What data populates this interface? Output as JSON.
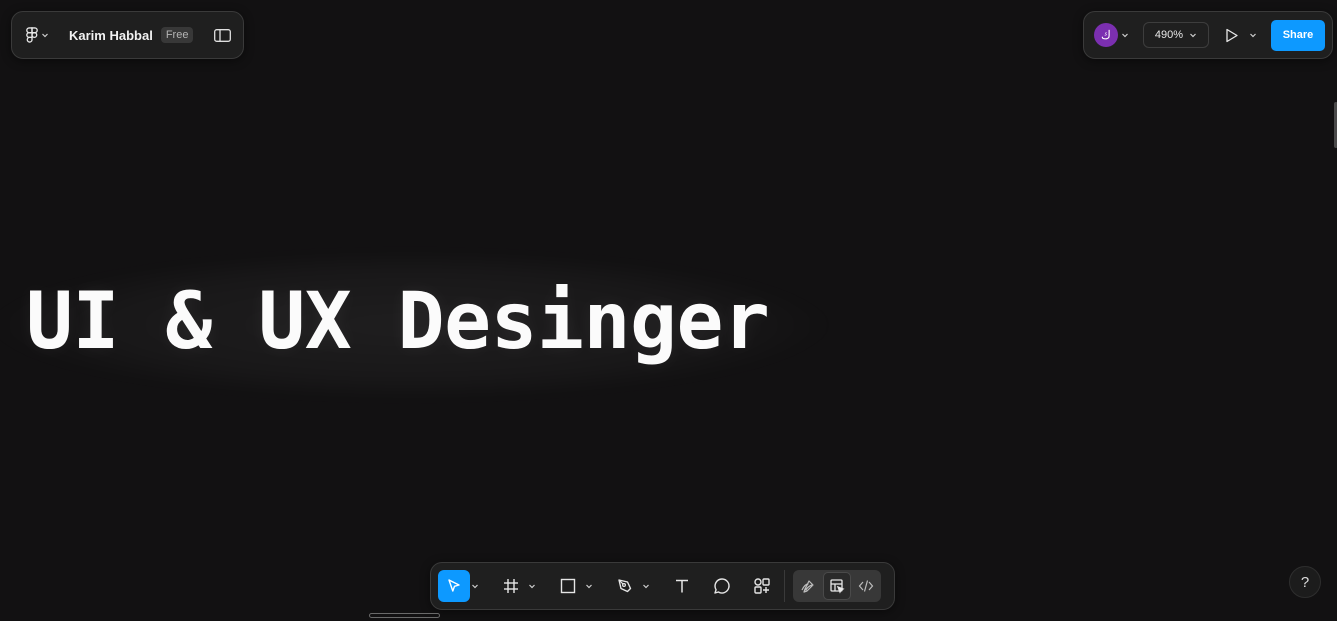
{
  "header": {
    "logo_icon": "figma-logo-icon",
    "owner_name": "Karim Habbal",
    "plan_badge": "Free",
    "sidebar_toggle_icon": "sidebar-panel-icon"
  },
  "top_right": {
    "avatar_initial": "ك",
    "avatar_color": "#7b2fb0",
    "zoom_level": "490%",
    "present_icon": "play-icon",
    "share_label": "Share",
    "share_color": "#0d99ff"
  },
  "canvas": {
    "text": "UI & UX Desinger"
  },
  "toolbar": {
    "tools": [
      {
        "name": "move",
        "icon": "cursor-icon",
        "active": true
      },
      {
        "name": "frame",
        "icon": "frame-hash-icon"
      },
      {
        "name": "shape",
        "icon": "rectangle-icon"
      },
      {
        "name": "pen",
        "icon": "pen-icon"
      },
      {
        "name": "text",
        "icon": "text-icon"
      },
      {
        "name": "comment",
        "icon": "comment-icon"
      },
      {
        "name": "resources",
        "icon": "resources-icon"
      }
    ],
    "modes": [
      {
        "name": "draw",
        "icon": "draw-mode-icon"
      },
      {
        "name": "design",
        "icon": "design-mode-icon",
        "selected": true
      },
      {
        "name": "dev",
        "icon": "dev-mode-icon"
      }
    ]
  },
  "help": {
    "label": "?"
  }
}
